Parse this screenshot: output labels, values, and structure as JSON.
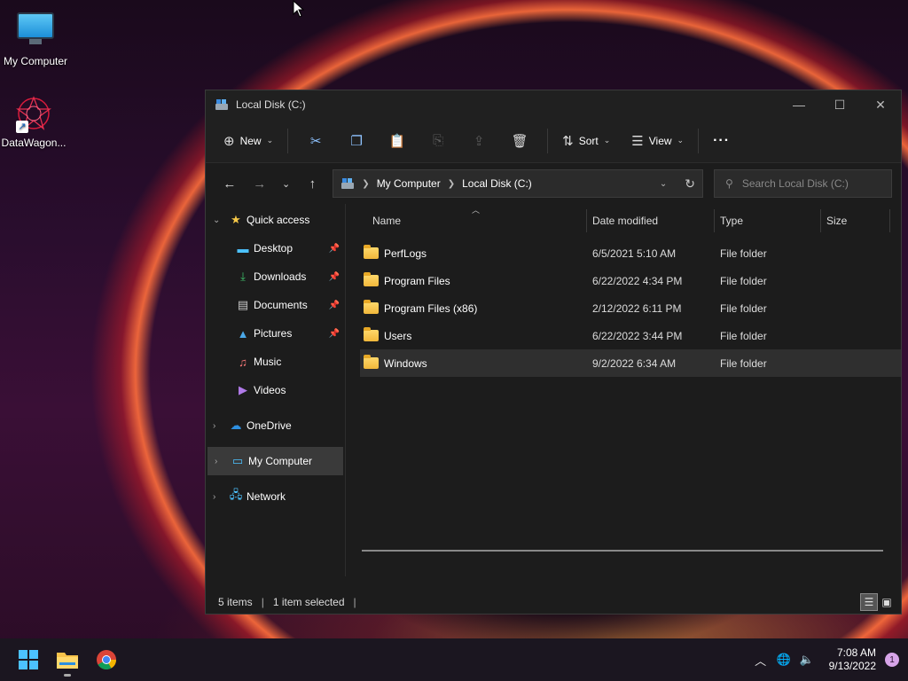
{
  "desktop": {
    "icons": [
      {
        "label": "My Computer",
        "icon": "monitor-icon"
      },
      {
        "label": "DataWagon...",
        "icon": "datawagon-logo"
      }
    ]
  },
  "window": {
    "title": "Local Disk (C:)",
    "controls": {
      "minimize": "—",
      "maximize": "☐",
      "close": "✕"
    }
  },
  "toolbar": {
    "new_label": "New",
    "sort_label": "Sort",
    "view_label": "View",
    "more": "···"
  },
  "address": {
    "crumbs": [
      "My Computer",
      "Local Disk (C:)"
    ],
    "search_placeholder": "Search Local Disk (C:)"
  },
  "nav": {
    "quick_access": "Quick access",
    "desktop": "Desktop",
    "downloads": "Downloads",
    "documents": "Documents",
    "pictures": "Pictures",
    "music": "Music",
    "videos": "Videos",
    "onedrive": "OneDrive",
    "my_computer": "My Computer",
    "network": "Network"
  },
  "columns": {
    "name": "Name",
    "date": "Date modified",
    "type": "Type",
    "size": "Size"
  },
  "files": [
    {
      "name": "PerfLogs",
      "date": "6/5/2021 5:10 AM",
      "type": "File folder"
    },
    {
      "name": "Program Files",
      "date": "6/22/2022 4:34 PM",
      "type": "File folder"
    },
    {
      "name": "Program Files (x86)",
      "date": "2/12/2022 6:11 PM",
      "type": "File folder"
    },
    {
      "name": "Users",
      "date": "6/22/2022 3:44 PM",
      "type": "File folder"
    },
    {
      "name": "Windows",
      "date": "9/2/2022 6:34 AM",
      "type": "File folder"
    }
  ],
  "status": {
    "items": "5 items",
    "selected": "1 item selected"
  },
  "taskbar": {
    "time": "7:08 AM",
    "date": "9/13/2022",
    "notifications": "1"
  },
  "colors": {
    "accent": "#4cc2ff",
    "folder": "#f7c24a",
    "selected_row": "#2f2f2f"
  }
}
